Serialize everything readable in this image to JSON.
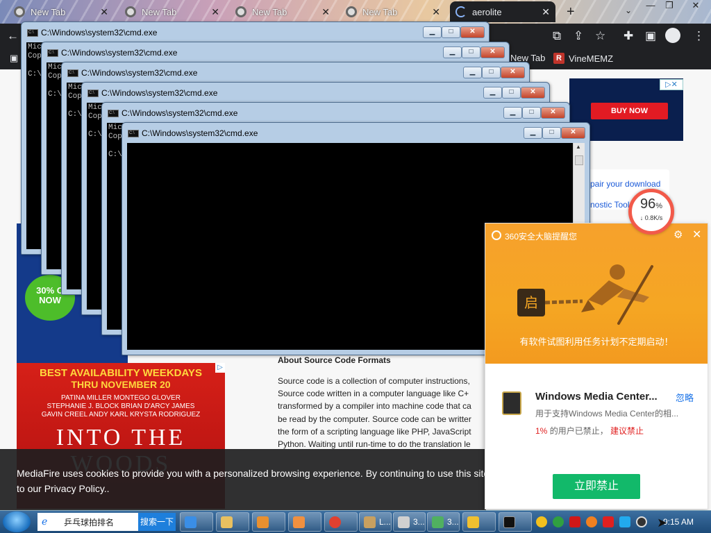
{
  "browser": {
    "tabs": [
      {
        "title": "New Tab",
        "active": false
      },
      {
        "title": "New Tab",
        "active": false
      },
      {
        "title": "New Tab",
        "active": false
      },
      {
        "title": "New Tab",
        "active": false
      },
      {
        "title": "aerolite",
        "active": true
      }
    ],
    "bookmarks": [
      {
        "label": "New Tab"
      },
      {
        "label": "VineMEMZ"
      }
    ]
  },
  "page": {
    "ad_top_button": "BUY NOW",
    "ad_badge": {
      "line1": "30% O",
      "line2": "NOW"
    },
    "repair_links": [
      "pair your download",
      "nostic Tool"
    ],
    "about_heading": "About Source Code Formats",
    "about_lines": [
      "Source code is a collection of computer instructions,",
      "Source code written in a computer language like C+",
      "transformed by a compiler into machine code that ca",
      "be read by the computer. Source code can be writter",
      "the form of a scripting language like PHP, JavaScript",
      "Python. Waiting until run-time to do the translation le"
    ],
    "ad_woods": {
      "headline1": "BEST AVAILABILITY WEEKDAYS",
      "headline2": "THRU NOVEMBER 20",
      "cast": [
        "PATINA MILLER     MONTEGO GLOVER",
        "STEPHANIE J. BLOCK   BRIAN D'ARCY JAMES",
        "GAVIN CREEL   ANDY KARL   KRYSTA RODRIGUEZ"
      ],
      "show_title": "INTO THE WOODS"
    },
    "cookie_text": "MediaFire uses cookies to provide you with a personalized browsing experience. By continuing to use this site, you ag\nto our Privacy Policy.."
  },
  "cmd_windows": [
    {
      "title": "C:\\Windows\\system32\\cmd.exe",
      "console": "Mic\nCop\n\nC:\\"
    },
    {
      "title": "C:\\Windows\\system32\\cmd.exe",
      "console": "Mic\nCop\n\nC:\\"
    },
    {
      "title": "C:\\Windows\\system32\\cmd.exe",
      "console": "Mic\nCop\n\nC:\\"
    },
    {
      "title": "C:\\Windows\\system32\\cmd.exe",
      "console": "Mic\nCop\n\nC:\\"
    },
    {
      "title": "C:\\Windows\\system32\\cmd.exe",
      "console": "Mic\nCop\n\nC:\\"
    },
    {
      "title": "C:\\Windows\\system32\\cmd.exe",
      "console": ""
    }
  ],
  "popup360": {
    "title": "360安全大脑提醒您",
    "message": "有软件试图利用任务计划不定期启动！",
    "app_icon_label": "启",
    "app_name": "Windows Media Center...",
    "ignore_label": "忽略",
    "app_desc": "用于支持Windows Media Center的相...",
    "stat_percent": "1%",
    "stat_text": "的用户已禁止，",
    "stat_link": "建议禁止",
    "ban_button": "立即禁止"
  },
  "gauge": {
    "value": "96",
    "unit": "%",
    "speed": "↓ 0.8K/s"
  },
  "taskbar": {
    "search_text": "乒乓球拍排名",
    "search_button": "搜索一下",
    "buttons": [
      "L...",
      "3...",
      "3..."
    ],
    "clock": "9:15 AM"
  },
  "colors": {
    "cmd_frame": "#b6cde5",
    "popup_orange": "#f5a623",
    "ban_green": "#12b96a",
    "taskbar_blue": "#1d4a78"
  }
}
